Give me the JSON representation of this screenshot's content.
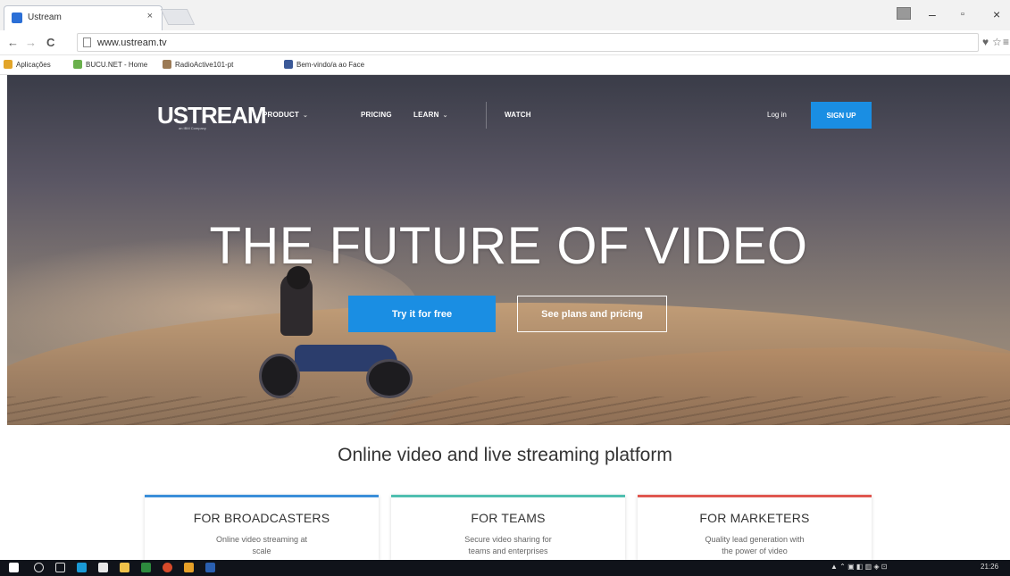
{
  "browser": {
    "tab_title": "Ustream",
    "tab_close": "×",
    "url": "www.ustream.tv",
    "back_glyph": "←",
    "forward_glyph": "→",
    "reload_glyph": "C",
    "window_min": "–",
    "window_max": "▫",
    "window_close": "×",
    "pin_glyph": "♥",
    "star_glyph": "☆",
    "menu_glyph": "≡"
  },
  "bookmarks": [
    {
      "label": "Aplicações",
      "color": "#e2a52a"
    },
    {
      "label": "BUCU.NET - Home",
      "color": "#6ab04c"
    },
    {
      "label": "RadioActive101-pt",
      "color": "#9b7a55"
    },
    {
      "label": "Bem-vindo/a ao Face",
      "color": "#3b5998"
    }
  ],
  "site": {
    "logo": "USTREAM",
    "logo_sub": "an IBM Company",
    "nav": {
      "product": "PRODUCT",
      "pricing": "PRICING",
      "learn": "LEARN",
      "watch": "WATCH",
      "caret": "⌄",
      "login": "Log in",
      "signup": "SIGN UP"
    },
    "headline": "THE FUTURE OF VIDEO",
    "cta_primary": "Try it for free",
    "cta_secondary": "See plans and pricing",
    "tagline": "Online video and live streaming platform",
    "cards": [
      {
        "title": "FOR BROADCASTERS",
        "desc": "Online video streaming at scale",
        "accent": "#3b8fd9"
      },
      {
        "title": "FOR TEAMS",
        "desc": "Secure video sharing for teams and enterprises",
        "accent": "#4fbfb0"
      },
      {
        "title": "FOR MARKETERS",
        "desc": "Quality lead generation with the power of video",
        "accent": "#e0574f"
      }
    ]
  },
  "taskbar": {
    "clock": "21:26",
    "icons": [
      "#1e5fd6",
      "#3a7be8",
      "#ffffff",
      "#1a9ad6",
      "#e8e8e8",
      "#f0c24a",
      "#2d8a3e",
      "#d64a2a",
      "#e6a028",
      "#2a5fb0"
    ]
  }
}
